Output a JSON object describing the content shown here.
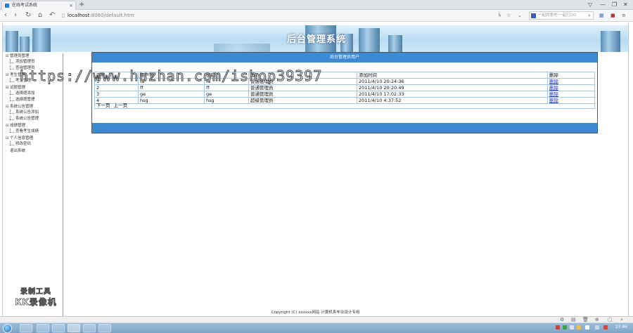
{
  "browser": {
    "tab_title": "在线考试系统",
    "tab_close": "×",
    "new_tab": "+",
    "window_buttons": [
      "▽",
      "—",
      "❐",
      "✕"
    ],
    "nav_icons": [
      "back-icon",
      "forward-icon",
      "refresh-icon",
      "home-icon",
      "undo-icon"
    ],
    "url_host": "localhost",
    "url_path": ":8080/default.htm",
    "search_placeholder": "一起同意吧 一起打OO",
    "search_icon": "search-icon"
  },
  "page": {
    "banner_title": "后台管理系统",
    "watermark": "https://www.huzhan.com/ishop39397",
    "copyright": "Copyright (C) xxxxxx网站 计算机系毕业设计专用",
    "recorder_line1": "录制工具",
    "recorder_line2": "KK录像机"
  },
  "sidebar": {
    "groups": [
      {
        "label": "管理员管理",
        "children": [
          "添加管理员",
          "查询管理员"
        ]
      },
      {
        "label": "考生管理",
        "children": [
          "考生管理"
        ]
      },
      {
        "label": "试题管理",
        "children": [
          "选择题添加",
          "选择题管理"
        ]
      },
      {
        "label": "系统公告管理",
        "children": [
          "系统公告添加",
          "系统公告管理"
        ]
      },
      {
        "label": "成绩管理",
        "children": [
          "查看考生成绩"
        ]
      },
      {
        "label": "个人信息管理",
        "children": [
          "修改密码"
        ]
      },
      {
        "label": "退出系统",
        "children": []
      }
    ]
  },
  "main": {
    "panel_title": "后台管理员用户",
    "columns": [
      "序号",
      "用户名",
      "密码",
      "角色",
      "添加时间",
      "删除"
    ],
    "rows": [
      [
        "1",
        "fa",
        "fa",
        "普通管理员",
        "2011/4/10 20:24:36",
        "删除"
      ],
      [
        "2",
        "ff",
        "ff",
        "普通管理员",
        "2011/4/10 20:20:49",
        "删除"
      ],
      [
        "3",
        "ge",
        "ge",
        "普通管理员",
        "2011/4/10 17:02:33",
        "删除"
      ],
      [
        "4",
        "hsg",
        "hsg",
        "超级管理员",
        "2011/4/10 4:37:52",
        "删除"
      ]
    ],
    "pager": {
      "next": "下一页",
      "prev": "上一页"
    }
  },
  "taskbar": {
    "clock": "23:46"
  },
  "colors": {
    "panel_header": "#3d8ad3",
    "table_border": "#9ec9e8",
    "link": "#2030c0"
  }
}
